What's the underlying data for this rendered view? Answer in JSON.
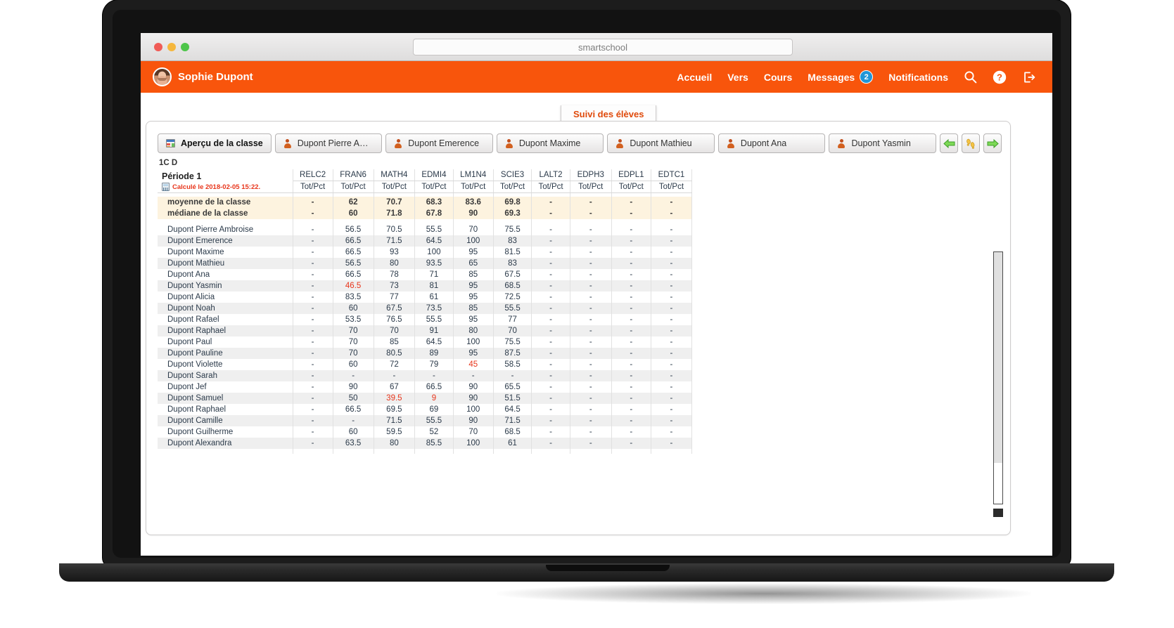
{
  "browser": {
    "url_value": "smartschool",
    "traffic_lights": [
      "close",
      "minimize",
      "zoom"
    ]
  },
  "topnav": {
    "user_name": "Sophie Dupont",
    "items": [
      {
        "label": "Accueil",
        "badge": null
      },
      {
        "label": "Vers",
        "badge": null
      },
      {
        "label": "Cours",
        "badge": null
      },
      {
        "label": "Messages",
        "badge": "2"
      },
      {
        "label": "Notifications",
        "badge": null
      }
    ],
    "icons": [
      "search-icon",
      "help-icon",
      "logout-icon"
    ],
    "accent_color": "#f8550c",
    "badge_color": "#2196d8"
  },
  "pill_tab": {
    "label": "Suivi des élèves"
  },
  "tabstrip": {
    "overview_tab": "Aperçu de la classe",
    "student_tabs": [
      "Dupont Pierre Ambroise",
      "Dupont Emerence",
      "Dupont Maxime",
      "Dupont Mathieu",
      "Dupont Ana",
      "Dupont Yasmin"
    ],
    "nav_buttons": [
      "arrow-left",
      "footsteps",
      "arrow-right"
    ]
  },
  "class_label": "1C D",
  "table": {
    "period_title": "Période 1",
    "calculated_text": "Calculé le 2018-02-05 15:22.",
    "subjects": [
      "RELC2",
      "FRAN6",
      "MATH4",
      "EDMI4",
      "LM1N4",
      "SCIE3",
      "LALT2",
      "EDPH3",
      "EDPL1",
      "EDTC1"
    ],
    "subheader": "Tot/Pct",
    "stats": [
      {
        "label": "moyenne de la classe",
        "values": [
          "-",
          "62",
          "70.7",
          "68.3",
          "83.6",
          "69.8",
          "-",
          "-",
          "-",
          "-"
        ]
      },
      {
        "label": "médiane de la classe",
        "values": [
          "-",
          "60",
          "71.8",
          "67.8",
          "90",
          "69.3",
          "-",
          "-",
          "-",
          "-"
        ]
      }
    ],
    "rows": [
      {
        "name": "Dupont Pierre Ambroise",
        "values": [
          "-",
          "56.5",
          "70.5",
          "55.5",
          "70",
          "75.5",
          "-",
          "-",
          "-",
          "-"
        ],
        "low": []
      },
      {
        "name": "Dupont Emerence",
        "values": [
          "-",
          "66.5",
          "71.5",
          "64.5",
          "100",
          "83",
          "-",
          "-",
          "-",
          "-"
        ],
        "low": []
      },
      {
        "name": "Dupont Maxime",
        "values": [
          "-",
          "66.5",
          "93",
          "100",
          "95",
          "81.5",
          "-",
          "-",
          "-",
          "-"
        ],
        "low": []
      },
      {
        "name": "Dupont Mathieu",
        "values": [
          "-",
          "56.5",
          "80",
          "93.5",
          "65",
          "83",
          "-",
          "-",
          "-",
          "-"
        ],
        "low": []
      },
      {
        "name": "Dupont Ana",
        "values": [
          "-",
          "66.5",
          "78",
          "71",
          "85",
          "67.5",
          "-",
          "-",
          "-",
          "-"
        ],
        "low": []
      },
      {
        "name": "Dupont Yasmin",
        "values": [
          "-",
          "46.5",
          "73",
          "81",
          "95",
          "68.5",
          "-",
          "-",
          "-",
          "-"
        ],
        "low": [
          1
        ]
      },
      {
        "name": "Dupont Alicia",
        "values": [
          "-",
          "83.5",
          "77",
          "61",
          "95",
          "72.5",
          "-",
          "-",
          "-",
          "-"
        ],
        "low": []
      },
      {
        "name": "Dupont Noah",
        "values": [
          "-",
          "60",
          "67.5",
          "73.5",
          "85",
          "55.5",
          "-",
          "-",
          "-",
          "-"
        ],
        "low": []
      },
      {
        "name": "Dupont Rafael",
        "values": [
          "-",
          "53.5",
          "76.5",
          "55.5",
          "95",
          "77",
          "-",
          "-",
          "-",
          "-"
        ],
        "low": []
      },
      {
        "name": "Dupont Raphael",
        "values": [
          "-",
          "70",
          "70",
          "91",
          "80",
          "70",
          "-",
          "-",
          "-",
          "-"
        ],
        "low": []
      },
      {
        "name": "Dupont Paul",
        "values": [
          "-",
          "70",
          "85",
          "64.5",
          "100",
          "75.5",
          "-",
          "-",
          "-",
          "-"
        ],
        "low": []
      },
      {
        "name": "Dupont Pauline",
        "values": [
          "-",
          "70",
          "80.5",
          "89",
          "95",
          "87.5",
          "-",
          "-",
          "-",
          "-"
        ],
        "low": []
      },
      {
        "name": "Dupont Violette",
        "values": [
          "-",
          "60",
          "72",
          "79",
          "45",
          "58.5",
          "-",
          "-",
          "-",
          "-"
        ],
        "low": [
          4
        ]
      },
      {
        "name": "Dupont Sarah",
        "values": [
          "-",
          "-",
          "-",
          "-",
          "-",
          "-",
          "-",
          "-",
          "-",
          "-"
        ],
        "low": []
      },
      {
        "name": "Dupont Jef",
        "values": [
          "-",
          "90",
          "67",
          "66.5",
          "90",
          "65.5",
          "-",
          "-",
          "-",
          "-"
        ],
        "low": []
      },
      {
        "name": "Dupont Samuel",
        "values": [
          "-",
          "50",
          "39.5",
          "9",
          "90",
          "51.5",
          "-",
          "-",
          "-",
          "-"
        ],
        "low": [
          2,
          3
        ]
      },
      {
        "name": "Dupont Raphael",
        "values": [
          "-",
          "66.5",
          "69.5",
          "69",
          "100",
          "64.5",
          "-",
          "-",
          "-",
          "-"
        ],
        "low": []
      },
      {
        "name": "Dupont Camille",
        "values": [
          "-",
          "-",
          "71.5",
          "55.5",
          "90",
          "71.5",
          "-",
          "-",
          "-",
          "-"
        ],
        "low": []
      },
      {
        "name": "Dupont Guilherme",
        "values": [
          "-",
          "60",
          "59.5",
          "52",
          "70",
          "68.5",
          "-",
          "-",
          "-",
          "-"
        ],
        "low": []
      },
      {
        "name": "Dupont Alexandra",
        "values": [
          "-",
          "63.5",
          "80",
          "85.5",
          "100",
          "61",
          "-",
          "-",
          "-",
          "-"
        ],
        "low": []
      }
    ]
  }
}
